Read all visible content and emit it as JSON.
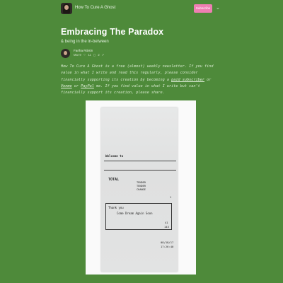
{
  "header": {
    "publication_name": "How To Cure A Ghost",
    "subscribe_label": "Subscribe",
    "menu_icon": "chevron-down-icon"
  },
  "post": {
    "title": "Embracing The Paradox",
    "subtitle": "& being in the in-between",
    "author": "Fariha Róisín",
    "date": "Mar 9",
    "likes": "11",
    "comments": "2",
    "intro": {
      "p1": "How To Cure A Ghost is a free (almost) weekly newsletter. If you find value in what I write and read this regularly, please consider financially supporting its creation by becoming a ",
      "link_paid": "paid subscriber",
      "p2": " or ",
      "link_venmo": "Venmo",
      "p3": " or ",
      "link_paypal": "PayPal",
      "p4": " me. If you find value in what I write but can't financially support its creation, please share."
    }
  },
  "receipt": {
    "welcome": "Welcome to",
    "total": "TOTAL",
    "tender1": "TENDER",
    "tender2": "TENDER",
    "change": "CHANGE",
    "value1": "1",
    "thank_you": "Thank you",
    "come_again": "Come Dream Again Soon",
    "num1": "41",
    "num2": "145",
    "date": "08/18/17",
    "time": "17:26:40"
  },
  "colors": {
    "background": "#4e8a3a",
    "subscribe": "#ef7fb2"
  }
}
